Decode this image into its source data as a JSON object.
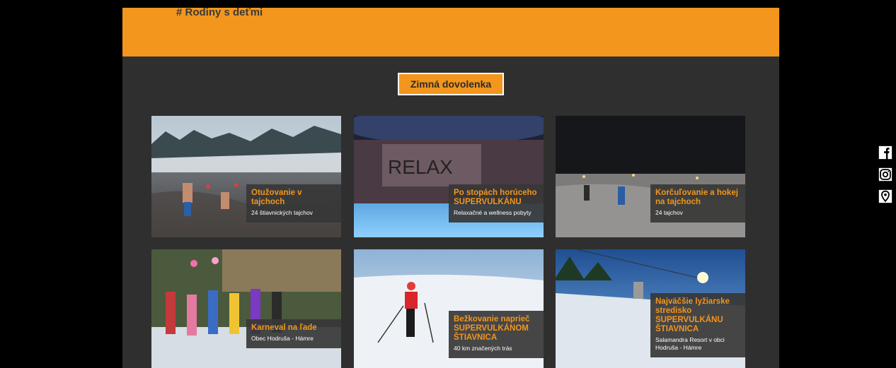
{
  "header": {
    "tag": "# Rodiny s deťmi"
  },
  "section": {
    "button_label": "Zimná dovolenka"
  },
  "cards": [
    {
      "title": "Otužovanie v tajchoch",
      "subtitle": "24 štiavnických tajchov",
      "image": "winter-swimming-photo"
    },
    {
      "title": "Po stopách horúceho SUPERVULKÁNU",
      "subtitle": "Relaxačné a wellness pobyty",
      "image": "relax-pool-photo",
      "image_text": "RELAX"
    },
    {
      "title": "Korčuľovanie a hokej na tajchoch",
      "subtitle": "24 tajchov",
      "image": "night-skating-photo"
    },
    {
      "title": "Karneval na ľade",
      "subtitle": "Obec Hodruša - Hámre",
      "image": "ice-carnival-photo"
    },
    {
      "title": "Bežkovanie naprieč SUPERVULKÁNOM ŠTIAVNICA",
      "subtitle": "40 km značených trás",
      "image": "cross-country-ski-photo"
    },
    {
      "title": "Najväčšie lyžiarske stredisko SUPERVULKÁNU ŠTIAVNICA",
      "subtitle": "Salamandra Resort v obci Hodruša - Hámre",
      "image": "ski-resort-photo"
    }
  ],
  "social": [
    "facebook-icon",
    "instagram-icon",
    "map-pin-icon"
  ],
  "colors": {
    "accent": "#f3961d",
    "panel": "#2f2f2f",
    "background": "#000000"
  }
}
